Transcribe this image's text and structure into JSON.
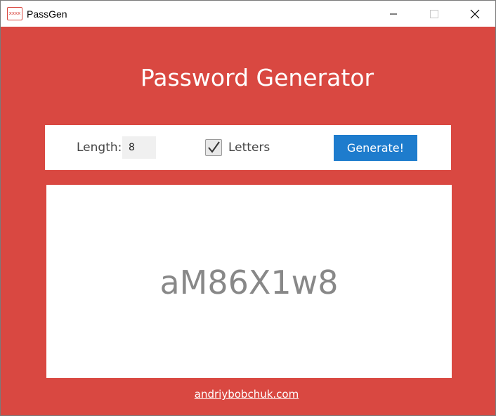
{
  "window": {
    "title": "PassGen",
    "icon_text": "xxxx",
    "controls": [
      "minimize-icon",
      "maximize-icon",
      "close-icon"
    ]
  },
  "main": {
    "heading": "Password Generator",
    "length_label": "Length:",
    "length_value": "8",
    "letters_label": "Letters",
    "letters_checked": true,
    "generate_label": "Generate!",
    "password": "aM86X1w8"
  },
  "footer": {
    "link_text": "andriybobchuk.com"
  },
  "colors": {
    "background": "#d94841",
    "button": "#1e7ccd",
    "password_text": "#888888"
  }
}
